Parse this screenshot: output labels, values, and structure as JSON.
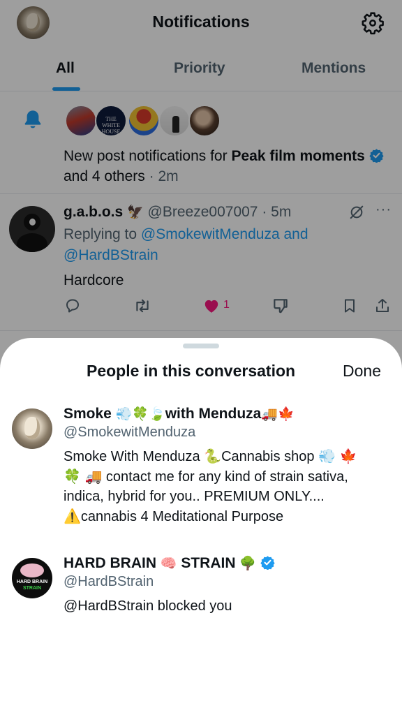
{
  "header": {
    "title": "Notifications",
    "tabs": [
      {
        "label": "All",
        "active": true
      },
      {
        "label": "Priority",
        "active": false
      },
      {
        "label": "Mentions",
        "active": false
      }
    ]
  },
  "post_notification": {
    "avatars": [
      "spiderman-avatar",
      "white-house-avatar",
      "spiderman-yellow-avatar",
      "silhouette-avatar",
      "man-portrait-avatar"
    ],
    "white_house_avatar_text": "THE WHITE HOUSE",
    "text_prefix": "New post notifications for ",
    "account_name": "Peak film moments",
    "text_suffix": " and 4 others",
    "time": "2m"
  },
  "tweet": {
    "display_name": "g.a.b.o.s",
    "handle": "@Breeze007007",
    "time": "5m",
    "replying_prefix": "Replying to ",
    "replying_to": "@SmokewitMenduza and @HardBStrain",
    "body": "Hardcore",
    "like_count": "1",
    "icons": [
      "reply-icon",
      "retweet-icon",
      "heart-icon",
      "dislike-icon",
      "bookmark-icon",
      "share-icon"
    ]
  },
  "sheet": {
    "title": "People in this conversation",
    "done_label": "Done",
    "people": [
      {
        "name_part1": "Smoke ",
        "name_emoji1": "💨🍀🍃",
        "name_part2": "with Menduza",
        "name_emoji2": "🚚🍁",
        "handle": "@SmokewitMenduza",
        "bio_line1": "Smoke With Menduza 🐍Cannabis shop 💨 🍁",
        "bio_line2": "🍀 🚚 contact me for any kind of strain sativa,",
        "bio_line3": "indica, hybrid for you.. PREMIUM ONLY....",
        "bio_line4": "⚠️cannabis 4 Meditational Purpose"
      },
      {
        "name_part1": "HARD BRAIN ",
        "name_emoji1": "🧠",
        "name_part2": " STRAIN ",
        "name_emoji2": "🌳",
        "handle": "@HardBStrain",
        "bio_line1": "@HardBStrain blocked you",
        "avatar_text1": "HARD BRAIN",
        "avatar_text2": "STRAIN"
      }
    ]
  },
  "colors": {
    "accent": "#1d9bf0",
    "like": "#f91880",
    "secondary_text": "#536471"
  }
}
